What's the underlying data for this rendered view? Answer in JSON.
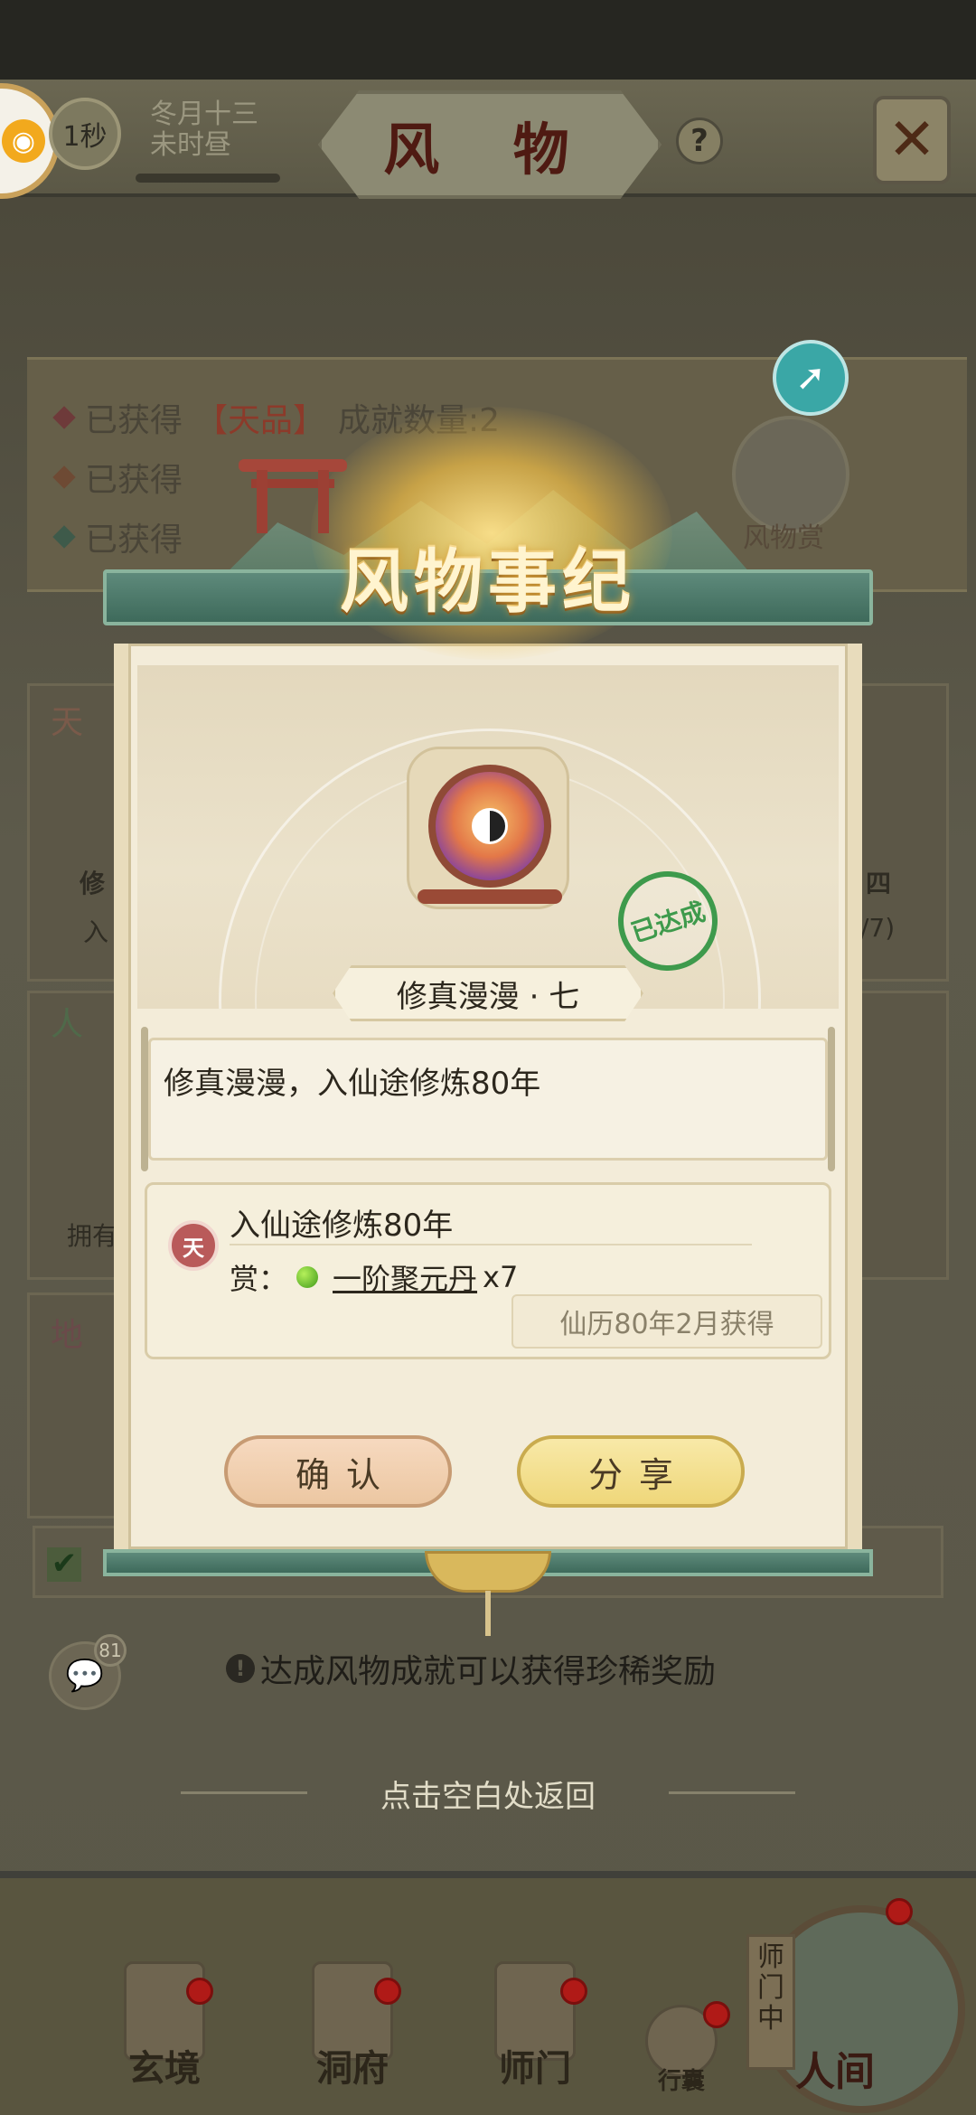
{
  "header": {
    "timer": "1秒",
    "date_line1": "冬月十三",
    "date_line2": "未时昼",
    "title": "风 物"
  },
  "background": {
    "achievements": [
      {
        "prefix": "已获得",
        "grade": "【天品】",
        "suffix": "成就数量:2"
      },
      {
        "prefix": "已获得",
        "grade": "",
        "suffix": ""
      },
      {
        "prefix": "已获得",
        "grade": "",
        "suffix": ""
      }
    ],
    "mascot_label": "风物赏",
    "card_left_1": "修",
    "card_left_2": "入",
    "card_right_1": "四",
    "card_right_2": "/7)",
    "card_left_3": "拥有",
    "side_tag_1": "天",
    "side_tag_2": "人",
    "side_tag_3": "地",
    "chat_badge_count": "81",
    "hint": "达成风物成就可以获得珍稀奖励",
    "back_hint": "点击空白处返回"
  },
  "modal": {
    "title": "风物事纪",
    "achievement_name": "修真漫漫 · 七",
    "stamp_text": "已达成",
    "description": "修真漫漫，入仙途修炼80年",
    "reward": {
      "badge": "天",
      "title": "入仙途修炼80年",
      "reward_label": "赏：",
      "item_name": "一阶聚元丹",
      "item_count": "x7",
      "obtained_at": "仙历80年2月获得"
    },
    "confirm_label": "确认",
    "share_label": "分享"
  },
  "bottom_nav": {
    "items": [
      "玄境",
      "洞府",
      "师门",
      "行囊"
    ],
    "world_label": "人间",
    "master_tag": "师门中"
  },
  "colors": {
    "accent_green": "#3e6a5b",
    "stamp_green": "#3e9a4c",
    "heaven_red": "#b95a5a",
    "confirm_button": "#ecc7a2",
    "share_button": "#efd77a"
  }
}
